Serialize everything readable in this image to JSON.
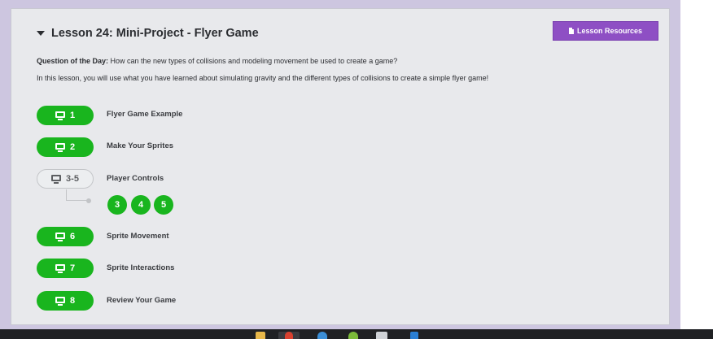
{
  "lesson": {
    "title": "Lesson 24: Mini-Project - Flyer Game",
    "resources_label": "Lesson Resources",
    "question_label": "Question of the Day:",
    "question_text": " How can the new types of collisions and modeling movement be used to create a game?",
    "intro": "In this lesson, you will use what you have learned about simulating gravity and the different types of collisions to create a simple flyer game!"
  },
  "levels": [
    {
      "number": "1",
      "name": "Flyer Game Example",
      "icon": "monitor-icon"
    },
    {
      "number": "2",
      "name": "Make Your Sprites",
      "icon": "monitor-icon"
    },
    {
      "number": "3-5",
      "name": "Player Controls",
      "icon": "monitor-icon",
      "sublevels": [
        "3",
        "4",
        "5"
      ]
    },
    {
      "number": "6",
      "name": "Sprite Movement",
      "icon": "monitor-icon"
    },
    {
      "number": "7",
      "name": "Sprite Interactions",
      "icon": "monitor-icon"
    },
    {
      "number": "8",
      "name": "Review Your Game",
      "icon": "monitor-icon"
    }
  ],
  "colors": {
    "accent_green": "#19b51e",
    "resources_purple": "#8e4fc4",
    "panel_bg": "#e8e9ec",
    "frame_bg": "#cdc6e0"
  }
}
